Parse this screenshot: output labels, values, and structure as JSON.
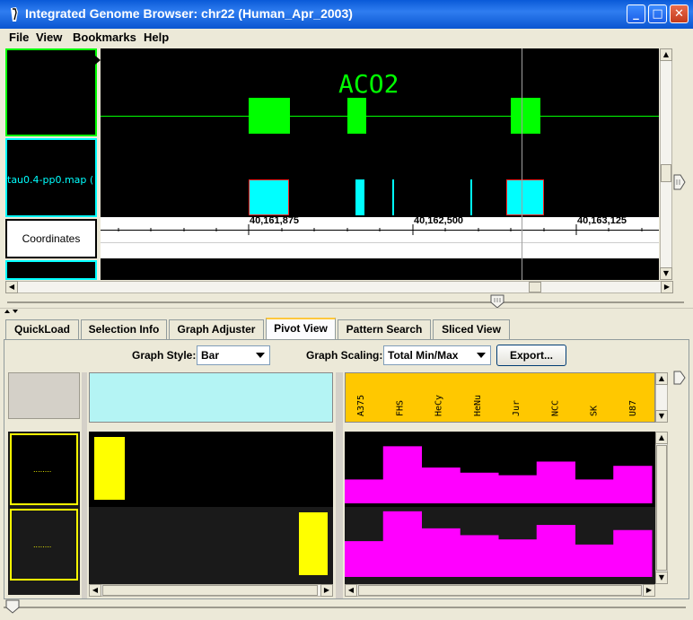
{
  "window": {
    "title": "Integrated Genome Browser: chr22 (Human_Apr_2003)",
    "buttons": [
      "_",
      "□",
      "✕"
    ]
  },
  "menu": [
    "File",
    "View",
    "Bookmarks",
    "Help"
  ],
  "tracks": {
    "gene_name": "ACO2",
    "probe_label": "tau0.4-pp0.map (",
    "coordinates_label": "Coordinates",
    "ticks": [
      "40,161,875",
      "40,162,500",
      "40,163,125"
    ]
  },
  "tabs": [
    {
      "label": "QuickLoad",
      "active": false
    },
    {
      "label": "Selection Info",
      "active": false
    },
    {
      "label": "Graph Adjuster",
      "active": false
    },
    {
      "label": "Pivot View",
      "active": true
    },
    {
      "label": "Pattern Search",
      "active": false
    },
    {
      "label": "Sliced View",
      "active": false
    }
  ],
  "pivot": {
    "graph_style_label": "Graph Style:",
    "graph_style_value": "Bar",
    "graph_scaling_label": "Graph Scaling:",
    "graph_scaling_value": "Total Min/Max",
    "export_label": "Export...",
    "row_labels": [
      "........",
      "........"
    ],
    "columns": [
      "A375",
      "FHS",
      "HeCy",
      "HeNu",
      "Jur",
      "NCC",
      "SK",
      "U87"
    ]
  },
  "colors": {
    "gene": "#00ff00",
    "probe": "#00ffff",
    "pivot_bars": "#ff00ff",
    "highlight": "#ffff00",
    "header": "#ffc800",
    "slice_header": "#b4f4f4"
  }
}
